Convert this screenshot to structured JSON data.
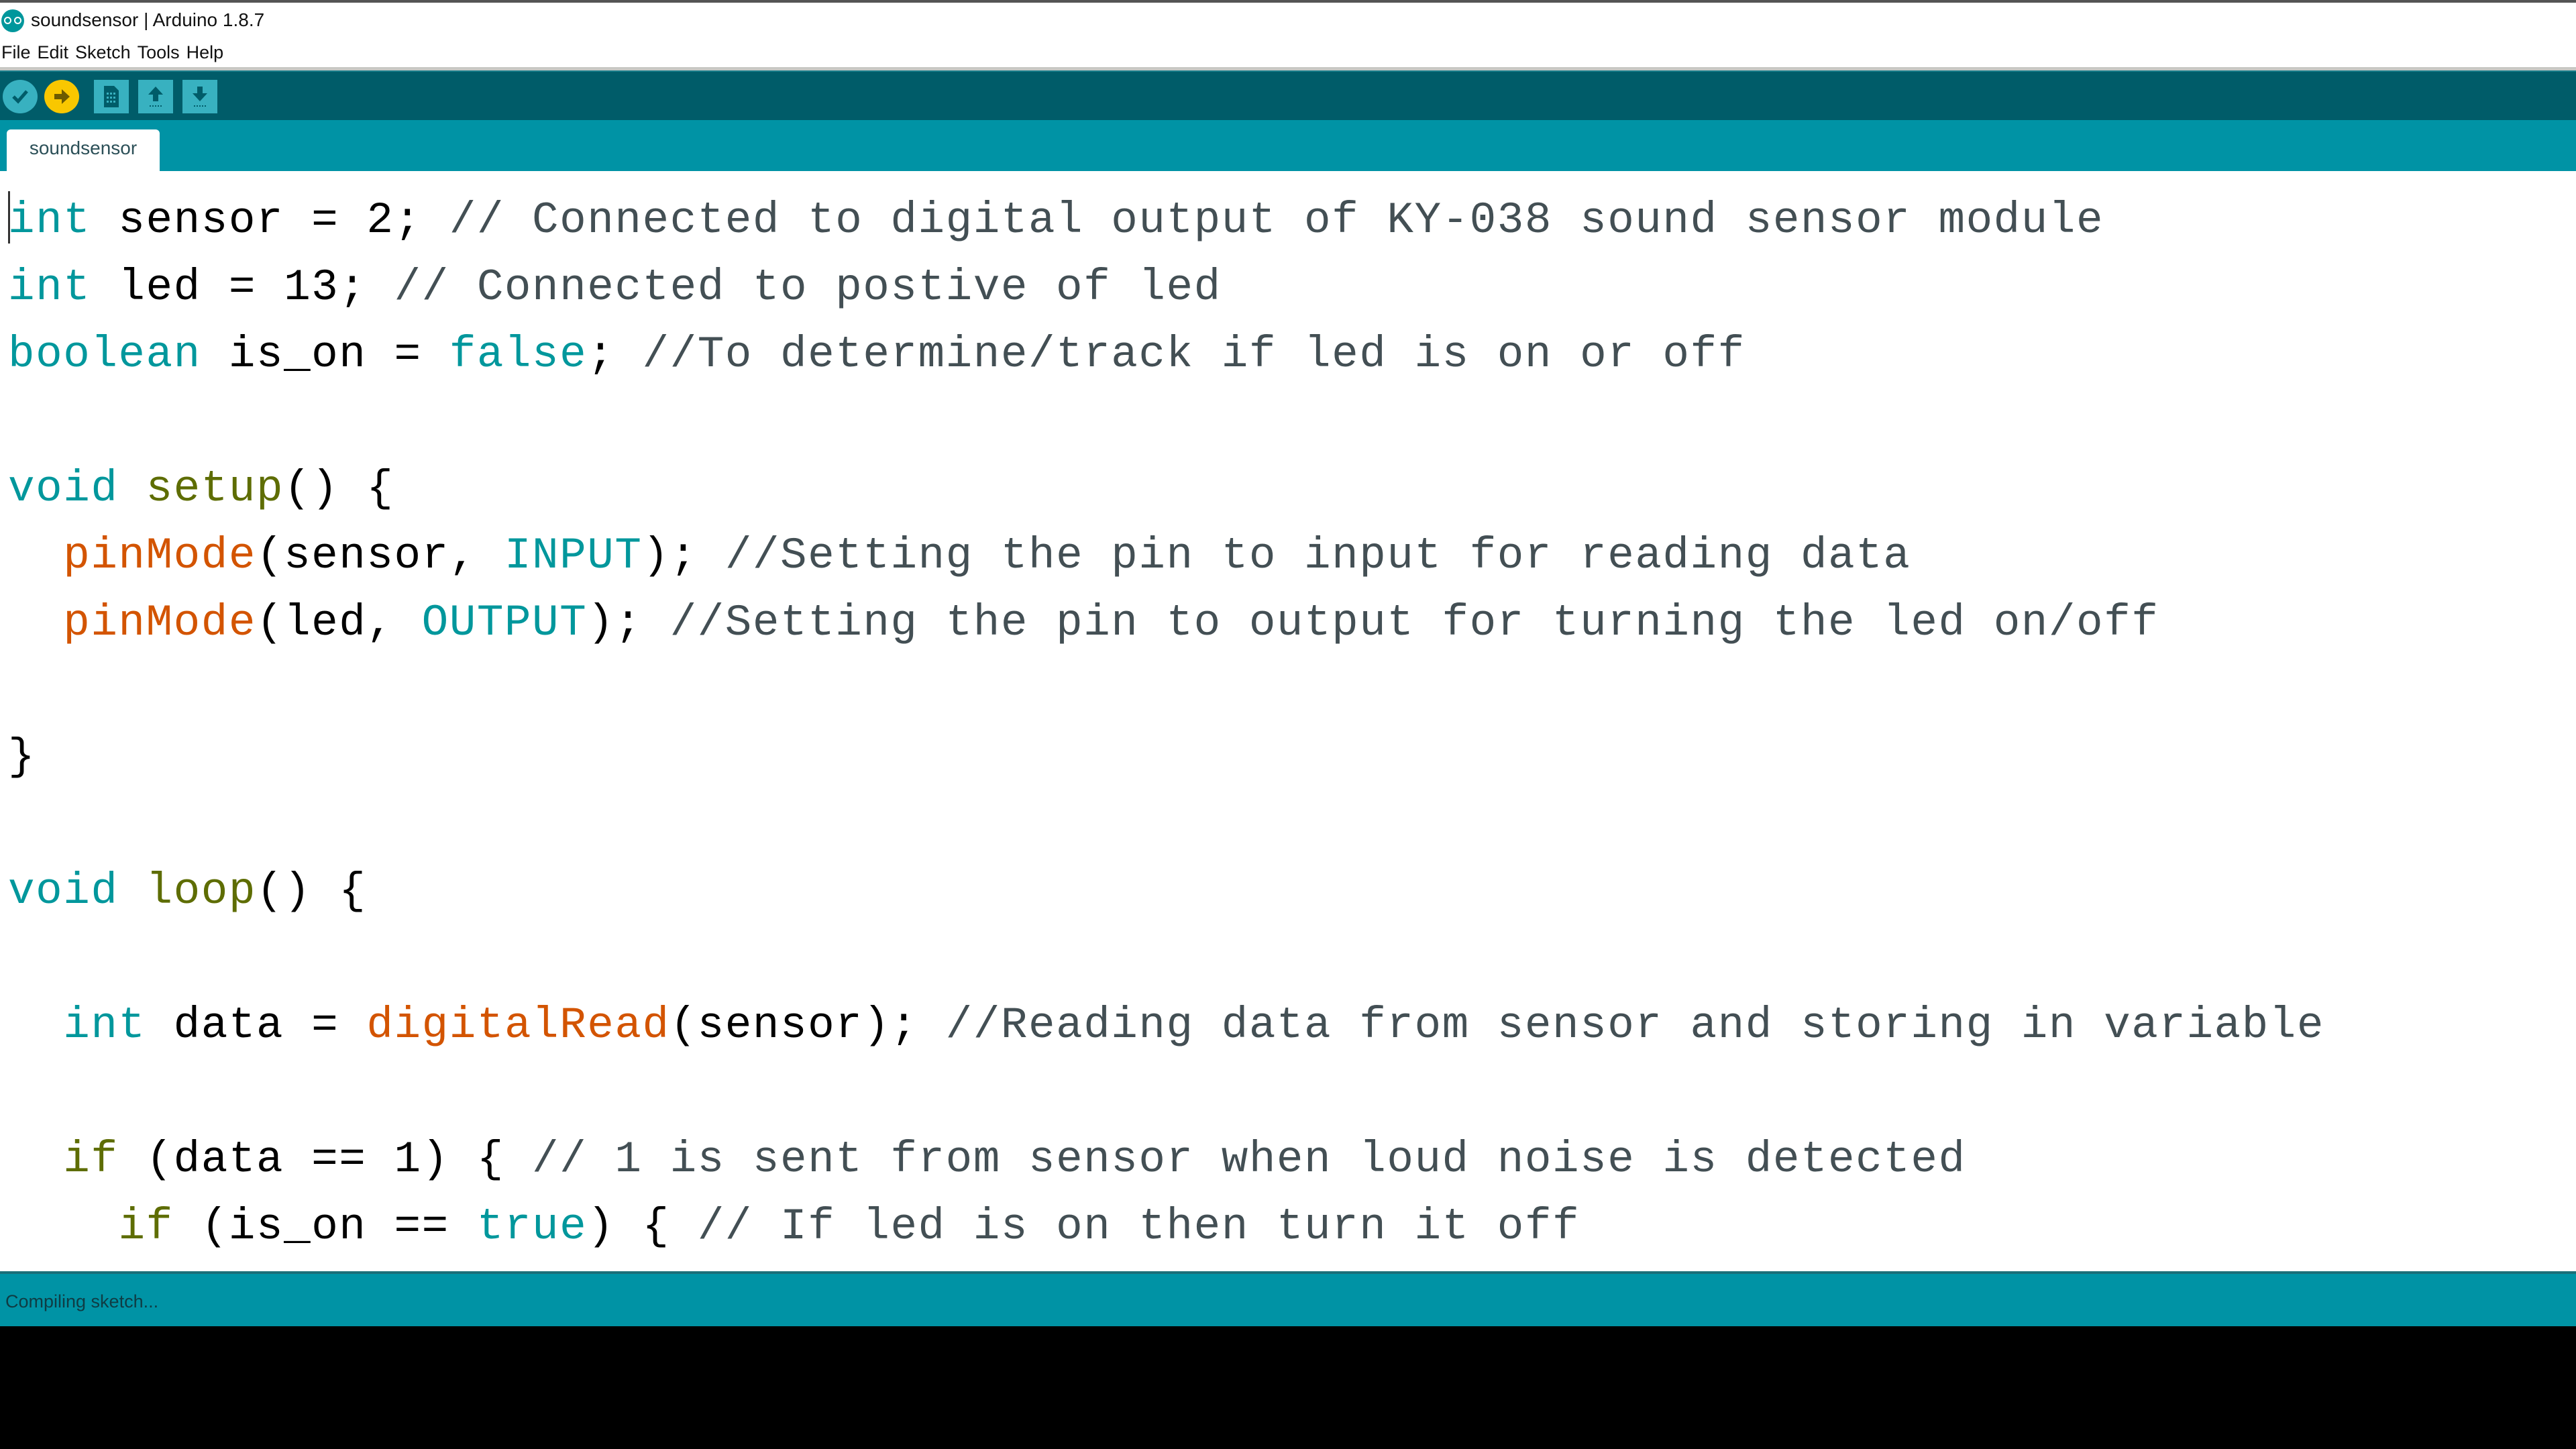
{
  "window": {
    "title": "soundsensor | Arduino 1.8.7",
    "icon": "arduino-logo-icon"
  },
  "menu": [
    {
      "label": "File"
    },
    {
      "label": "Edit"
    },
    {
      "label": "Sketch"
    },
    {
      "label": "Tools"
    },
    {
      "label": "Help"
    }
  ],
  "toolbar": {
    "buttons": [
      {
        "name": "verify",
        "icon": "checkmark-icon",
        "glyph": "✓",
        "state": "normal"
      },
      {
        "name": "upload",
        "icon": "arrow-right-icon",
        "glyph": "➜",
        "state": "hover"
      },
      {
        "name": "new",
        "icon": "new-file-icon",
        "glyph": "▤"
      },
      {
        "name": "open",
        "icon": "arrow-up-icon",
        "glyph": "⭡"
      },
      {
        "name": "save",
        "icon": "arrow-down-icon",
        "glyph": "⭣"
      }
    ]
  },
  "tabs": [
    {
      "label": "soundsensor",
      "active": true
    }
  ],
  "editor": {
    "lines": [
      [
        [
          "kw",
          "int"
        ],
        [
          "",
          "  sensor = 2; "
        ],
        [
          "cm",
          "// Connected to digital output of KY-038 sound sensor module"
        ]
      ],
      [
        [
          "kw",
          "int"
        ],
        [
          "",
          " led = 13; "
        ],
        [
          "cm",
          "// Connected to postive of led"
        ]
      ],
      [
        [
          "kw",
          "boolean"
        ],
        [
          "",
          " is_on = "
        ],
        [
          "kw",
          "false"
        ],
        [
          "",
          "; "
        ],
        [
          "cm",
          "//To determine/track if led is on or off"
        ]
      ],
      [],
      [
        [
          "kw",
          "void"
        ],
        [
          "",
          " "
        ],
        [
          "sf",
          "setup"
        ],
        [
          "",
          "() {"
        ]
      ],
      [
        [
          "",
          "  "
        ],
        [
          "fn",
          "pinMode"
        ],
        [
          "",
          "(sensor, "
        ],
        [
          "kw",
          "INPUT"
        ],
        [
          "",
          "); "
        ],
        [
          "cm",
          "//Setting the pin to input for reading data"
        ]
      ],
      [
        [
          "",
          "  "
        ],
        [
          "fn",
          "pinMode"
        ],
        [
          "",
          "(led, "
        ],
        [
          "kw",
          "OUTPUT"
        ],
        [
          "",
          "); "
        ],
        [
          "cm",
          "//Setting the pin to output for turning the led on/off"
        ]
      ],
      [],
      [
        [
          "",
          "}"
        ]
      ],
      [],
      [
        [
          "kw",
          "void"
        ],
        [
          "",
          " "
        ],
        [
          "sf",
          "loop"
        ],
        [
          "",
          "() {"
        ]
      ],
      [],
      [
        [
          "",
          "  "
        ],
        [
          "kw",
          "int"
        ],
        [
          "",
          " data = "
        ],
        [
          "fn",
          "digitalRead"
        ],
        [
          "",
          "(sensor); "
        ],
        [
          "cm",
          "//Reading data from sensor and storing in variable"
        ]
      ],
      [],
      [
        [
          "",
          "  "
        ],
        [
          "sf",
          "if"
        ],
        [
          "",
          " (data == 1) { "
        ],
        [
          "cm",
          "// 1 is sent from sensor when loud noise is detected"
        ]
      ],
      [
        [
          "",
          "    "
        ],
        [
          "sf",
          "if"
        ],
        [
          "",
          " (is_on == "
        ],
        [
          "kw",
          "true"
        ],
        [
          "",
          ") { "
        ],
        [
          "cm",
          "// If led is on then turn it off"
        ]
      ]
    ]
  },
  "status": {
    "message": "Compiling sketch..."
  },
  "colors": {
    "toolbar_bg": "#005c69",
    "tabbar_bg": "#0093a5",
    "keyword": "#00979c",
    "function": "#d35400",
    "structure": "#5e6d03",
    "comment": "#434f54",
    "upload_hover": "#f9c700"
  }
}
